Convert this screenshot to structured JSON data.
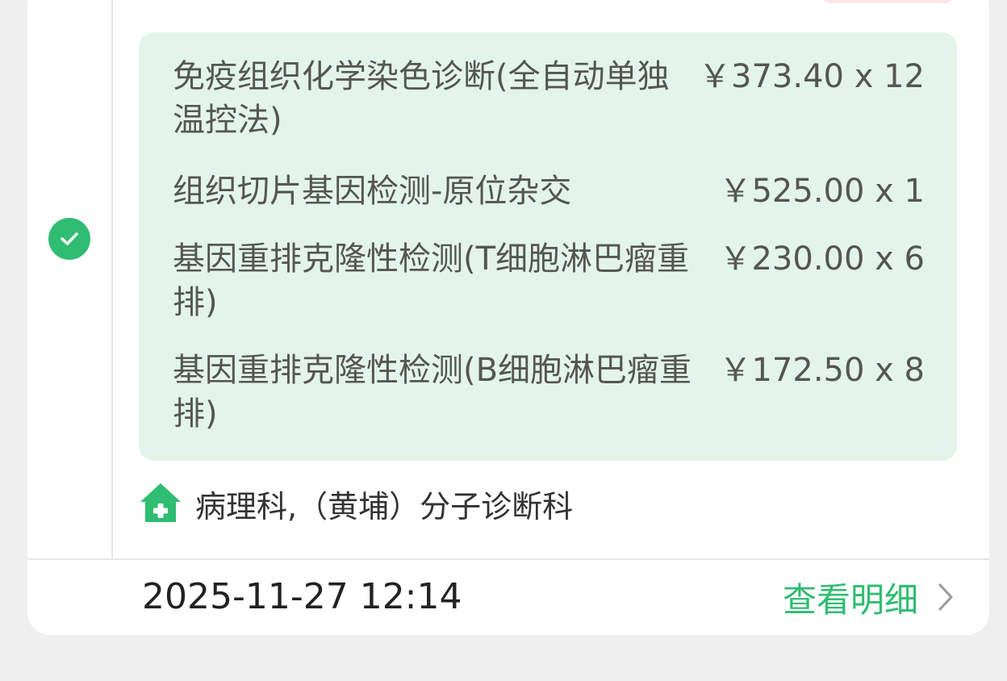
{
  "items": [
    {
      "name": "免疫组织化学染色诊断(全自动单独温控法)",
      "price": "￥373.40 x 12"
    },
    {
      "name": "组织切片基因检测-原位杂交",
      "price": "￥525.00 x 1"
    },
    {
      "name": "基因重排克隆性检测(T细胞淋巴瘤重排)",
      "price": "￥230.00 x 6"
    },
    {
      "name": "基因重排克隆性检测(B细胞淋巴瘤重排)",
      "price": "￥172.50 x 8"
    }
  ],
  "department": {
    "icon": "hospital-icon",
    "text": "病理科,（黄埔）分子诊断科"
  },
  "footer": {
    "datetime": "2025-11-27 12:14",
    "detail_link": "查看明细"
  },
  "colors": {
    "accent": "#2fbd71",
    "items_bg": "#e3f5eb",
    "page_bg": "#efefef"
  }
}
